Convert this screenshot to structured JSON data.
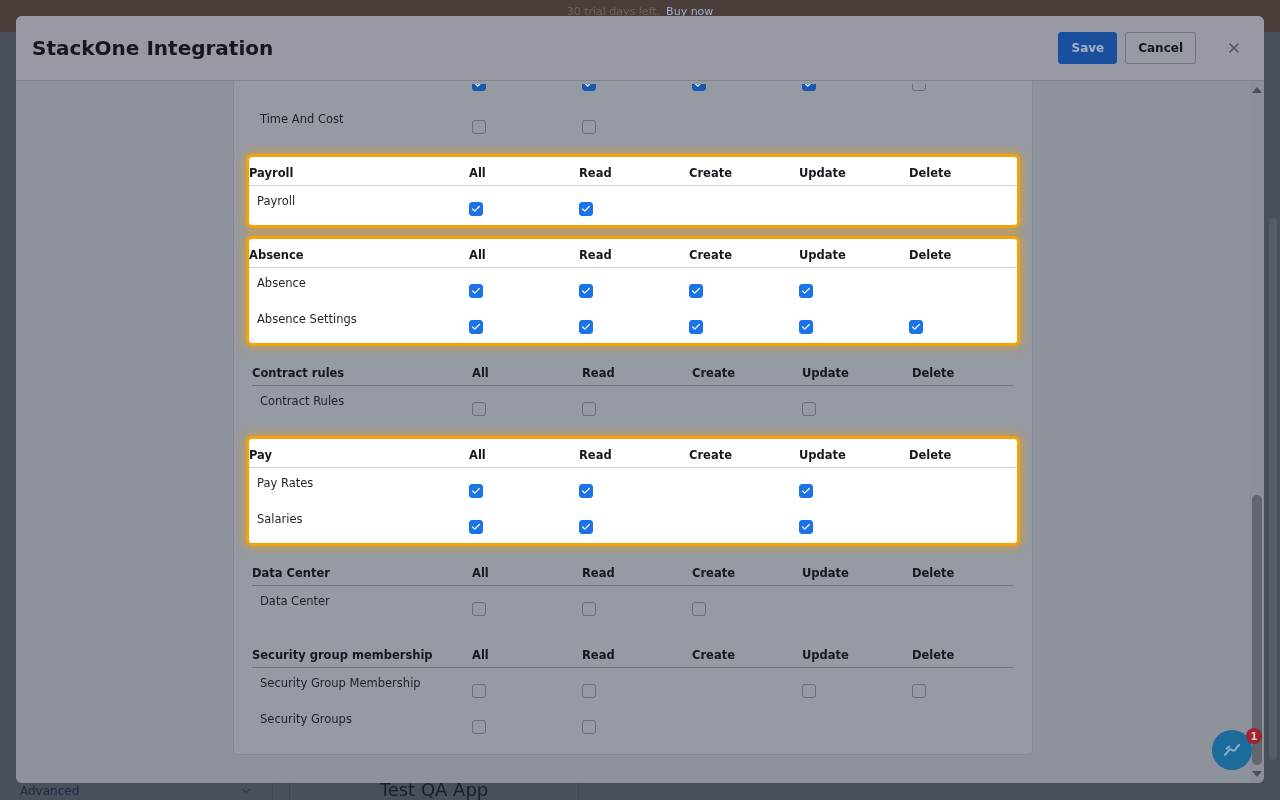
{
  "banner": {
    "text": "30 trial days left.",
    "link": "Buy now"
  },
  "background": {
    "sidebar_select": "Advanced",
    "app_title": "Test QA App"
  },
  "modal": {
    "title": "StackOne Integration",
    "buttons": [
      {
        "label": "Save",
        "kind": "primary"
      },
      {
        "label": "Cancel",
        "kind": "secondary"
      }
    ],
    "sections": [
      {
        "highlighted": false,
        "rows": [
          {
            "kind": "partial",
            "cells": [
              {
                "kind": "checkbox",
                "checked": true
              },
              {
                "kind": "checkbox",
                "checked": true
              },
              {
                "kind": "checkbox",
                "checked": true
              },
              {
                "kind": "checkbox",
                "checked": true
              },
              {
                "kind": "checkbox",
                "checked": false
              }
            ]
          },
          {
            "kind": "full",
            "name": "Time And Cost",
            "cells": [
              {
                "kind": "checkbox",
                "checked": false
              },
              {
                "kind": "checkbox",
                "checked": false
              },
              {
                "kind": "empty"
              },
              {
                "kind": "empty"
              },
              {
                "kind": "empty"
              }
            ]
          }
        ]
      },
      {
        "title": "Payroll",
        "columns": [
          "All",
          "Read",
          "Create",
          "Update",
          "Delete"
        ],
        "highlighted": true,
        "rows": [
          {
            "kind": "full",
            "name": "Payroll",
            "cells": [
              {
                "kind": "checkbox",
                "checked": true
              },
              {
                "kind": "checkbox",
                "checked": true
              },
              {
                "kind": "empty"
              },
              {
                "kind": "empty"
              },
              {
                "kind": "empty"
              }
            ]
          }
        ]
      },
      {
        "title": "Absence",
        "columns": [
          "All",
          "Read",
          "Create",
          "Update",
          "Delete"
        ],
        "highlighted": true,
        "rows": [
          {
            "kind": "full",
            "name": "Absence",
            "cells": [
              {
                "kind": "checkbox",
                "checked": true
              },
              {
                "kind": "checkbox",
                "checked": true
              },
              {
                "kind": "checkbox",
                "checked": true
              },
              {
                "kind": "checkbox",
                "checked": true
              },
              {
                "kind": "empty"
              }
            ]
          },
          {
            "kind": "full",
            "name": "Absence Settings",
            "cells": [
              {
                "kind": "checkbox",
                "checked": true
              },
              {
                "kind": "checkbox",
                "checked": true
              },
              {
                "kind": "checkbox",
                "checked": true
              },
              {
                "kind": "checkbox",
                "checked": true
              },
              {
                "kind": "checkbox",
                "checked": true
              }
            ]
          }
        ]
      },
      {
        "title": "Contract rules",
        "columns": [
          "All",
          "Read",
          "Create",
          "Update",
          "Delete"
        ],
        "highlighted": false,
        "rows": [
          {
            "kind": "full",
            "name": "Contract Rules",
            "cells": [
              {
                "kind": "checkbox",
                "checked": false
              },
              {
                "kind": "checkbox",
                "checked": false
              },
              {
                "kind": "empty"
              },
              {
                "kind": "checkbox",
                "checked": false
              },
              {
                "kind": "empty"
              }
            ]
          }
        ]
      },
      {
        "title": "Pay",
        "columns": [
          "All",
          "Read",
          "Create",
          "Update",
          "Delete"
        ],
        "highlighted": true,
        "rows": [
          {
            "kind": "full",
            "name": "Pay Rates",
            "cells": [
              {
                "kind": "checkbox",
                "checked": true
              },
              {
                "kind": "checkbox",
                "checked": true
              },
              {
                "kind": "empty"
              },
              {
                "kind": "checkbox",
                "checked": true
              },
              {
                "kind": "empty"
              }
            ]
          },
          {
            "kind": "full",
            "name": "Salaries",
            "cells": [
              {
                "kind": "checkbox",
                "checked": true
              },
              {
                "kind": "checkbox",
                "checked": true
              },
              {
                "kind": "empty"
              },
              {
                "kind": "checkbox",
                "checked": true
              },
              {
                "kind": "empty"
              }
            ]
          }
        ]
      },
      {
        "title": "Data Center",
        "columns": [
          "All",
          "Read",
          "Create",
          "Update",
          "Delete"
        ],
        "highlighted": false,
        "rows": [
          {
            "kind": "full",
            "name": "Data Center",
            "cells": [
              {
                "kind": "checkbox",
                "checked": false
              },
              {
                "kind": "checkbox",
                "checked": false
              },
              {
                "kind": "checkbox",
                "checked": false
              },
              {
                "kind": "empty"
              },
              {
                "kind": "empty"
              }
            ]
          }
        ]
      },
      {
        "title": "Security group membership",
        "columns": [
          "All",
          "Read",
          "Create",
          "Update",
          "Delete"
        ],
        "highlighted": false,
        "rows": [
          {
            "kind": "full",
            "name": "Security Group Membership",
            "cells": [
              {
                "kind": "checkbox",
                "checked": false
              },
              {
                "kind": "checkbox",
                "checked": false
              },
              {
                "kind": "empty"
              },
              {
                "kind": "checkbox",
                "checked": false
              },
              {
                "kind": "checkbox",
                "checked": false
              }
            ]
          },
          {
            "kind": "full",
            "name": "Security Groups",
            "cells": [
              {
                "kind": "checkbox",
                "checked": false
              },
              {
                "kind": "checkbox",
                "checked": false
              },
              {
                "kind": "empty"
              },
              {
                "kind": "empty"
              },
              {
                "kind": "empty"
              }
            ]
          }
        ]
      }
    ]
  },
  "chat": {
    "badge": "1"
  }
}
